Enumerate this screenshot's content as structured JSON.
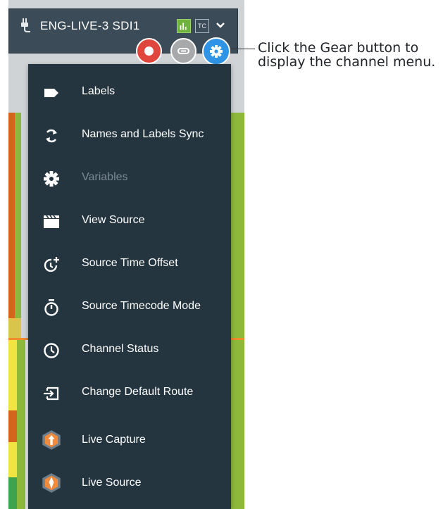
{
  "channel": {
    "name": "ENG-LIVE-3 SDI1",
    "tc_badge": "TC"
  },
  "callout": {
    "line1": "Click the Gear button to",
    "line2": "display the channel menu."
  },
  "menu": {
    "items": [
      {
        "label": "Labels",
        "icon": "label-tag-icon",
        "enabled": true
      },
      {
        "label": "Names and Labels Sync",
        "icon": "sync-icon",
        "enabled": true
      },
      {
        "label": "Variables",
        "icon": "gear-icon",
        "enabled": false
      },
      {
        "label": "View Source",
        "icon": "clapperboard-icon",
        "enabled": true
      },
      {
        "label": "Source Time Offset",
        "icon": "clock-plus-icon",
        "enabled": true
      },
      {
        "label": "Source Timecode Mode",
        "icon": "stopwatch-icon",
        "enabled": true
      },
      {
        "label": "Channel Status",
        "icon": "clock-icon",
        "enabled": true
      },
      {
        "label": "Change Default Route",
        "icon": "route-input-icon",
        "enabled": true
      },
      {
        "label": "Live Capture",
        "icon": "live-capture-icon",
        "enabled": true
      },
      {
        "label": "Live Source",
        "icon": "live-source-icon",
        "enabled": true
      }
    ]
  },
  "colors": {
    "header_bg": "#3b4b58",
    "menu_bg": "#243540",
    "record": "#e0463b",
    "link": "#a8a9ab",
    "gear": "#2f94e6",
    "meter": "#6fb33d"
  }
}
